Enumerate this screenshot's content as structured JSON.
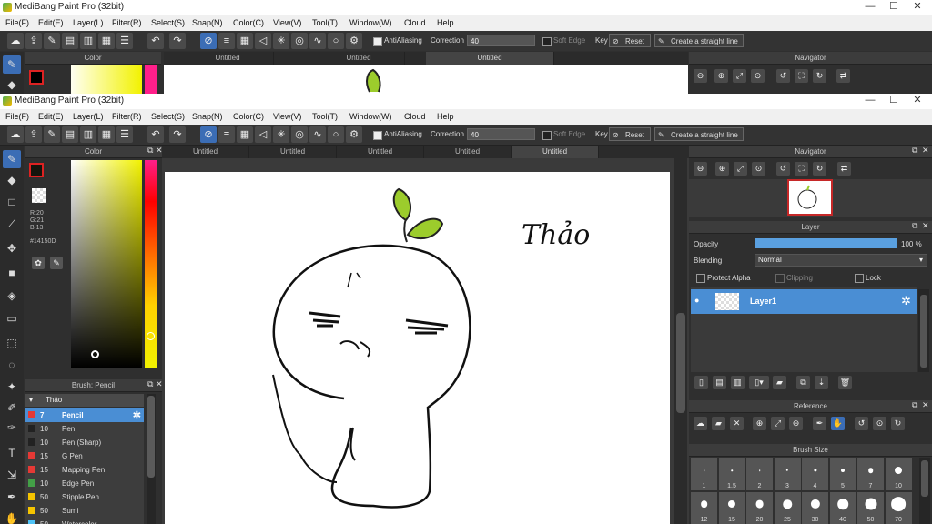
{
  "app": {
    "title": "MediBang Paint Pro (32bit)"
  },
  "window_controls": {
    "minimize": "—",
    "maximize": "☐",
    "close": "✕"
  },
  "menu": [
    "File(F)",
    "Edit(E)",
    "Layer(L)",
    "Filter(R)",
    "Select(S)",
    "Snap(N)",
    "Color(C)",
    "View(V)",
    "Tool(T)",
    "Window(W)",
    "Cloud",
    "Help"
  ],
  "toolbar": {
    "antialiasing_label": "AntiAliasing",
    "correction_label": "Correction",
    "correction_value": "40",
    "soft_edge_label": "Soft Edge",
    "key_label": "Key",
    "reset_label": "Reset",
    "straight_line_label": "Create a straight line"
  },
  "bg_window": {
    "tabs": [
      "Untitled",
      "Untitled",
      "Untitled"
    ],
    "color_header": "Color",
    "navigator_header": "Navigator"
  },
  "tabs": [
    "Untitled",
    "Untitled",
    "Untitled",
    "Untitled",
    "Untitled"
  ],
  "color_panel": {
    "header": "Color",
    "r": "R:20",
    "g": "G:21",
    "b": "B:13",
    "hex": "#14150D"
  },
  "brush_panel": {
    "header": "Brush: Pencil",
    "group": "Thảo",
    "brushes": [
      {
        "size": "7",
        "name": "Pencil",
        "color": "#e53935"
      },
      {
        "size": "10",
        "name": "Pen",
        "color": "#222222"
      },
      {
        "size": "10",
        "name": "Pen (Sharp)",
        "color": "#222222"
      },
      {
        "size": "15",
        "name": "G Pen",
        "color": "#e53935"
      },
      {
        "size": "15",
        "name": "Mapping Pen",
        "color": "#e53935"
      },
      {
        "size": "10",
        "name": "Edge Pen",
        "color": "#43a047"
      },
      {
        "size": "50",
        "name": "Stipple Pen",
        "color": "#f5c400"
      },
      {
        "size": "50",
        "name": "Sumi",
        "color": "#f5c400"
      },
      {
        "size": "50",
        "name": "Watercolor",
        "color": "#4fc3f7"
      }
    ]
  },
  "canvas": {
    "handwriting": "Thảo"
  },
  "navigator": {
    "header": "Navigator"
  },
  "layer_panel": {
    "header": "Layer",
    "opacity_label": "Opacity",
    "opacity_value": "100 %",
    "opacity_fraction": 1.0,
    "blending_label": "Blending",
    "blending_value": "Normal",
    "protect_alpha": "Protect Alpha",
    "clipping": "Clipping",
    "lock": "Lock",
    "layer_name": "Layer1"
  },
  "reference": {
    "header": "Reference"
  },
  "brush_size": {
    "header": "Brush Size",
    "row1": [
      "1",
      "1.5",
      "2",
      "3",
      "4",
      "5",
      "7",
      "10"
    ],
    "row2": [
      "12",
      "15",
      "20",
      "25",
      "30",
      "40",
      "50",
      "70"
    ]
  },
  "colors": {
    "accent": "#4a8ed4",
    "leaf": "#9ccc2c",
    "canvas": "#ffffff",
    "panel": "#2f2f2f"
  }
}
